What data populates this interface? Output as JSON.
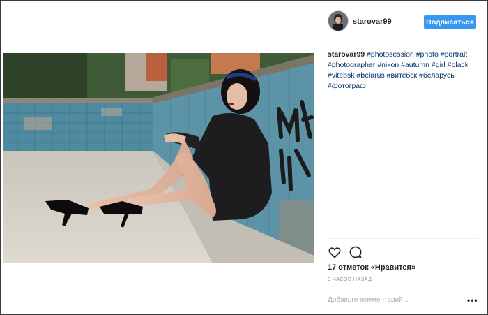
{
  "post": {
    "username": "starovar99",
    "follow_label": "Подписаться",
    "caption": {
      "author": "starovar99",
      "tags": [
        "#photosession",
        "#photo",
        "#portrait",
        "#photographer",
        "#nikon",
        "#autumn",
        "#girl",
        "#black",
        "#vitebsk",
        "#belarus",
        "#витебск",
        "#беларусь",
        "#фотограф"
      ]
    },
    "likes_text": "17 отметок «Нравится»",
    "timestamp": "9 ЧАСОВ НАЗАД",
    "comment_placeholder": "Добавьте комментарий...",
    "more_label": "•••"
  },
  "icons": {
    "like": "heart-icon",
    "comment": "comment-bubble-icon",
    "more": "more-options-icon"
  },
  "colors": {
    "follow_button": "#3897f0",
    "hashtag": "#003569",
    "text": "#262626",
    "muted": "#999999"
  }
}
